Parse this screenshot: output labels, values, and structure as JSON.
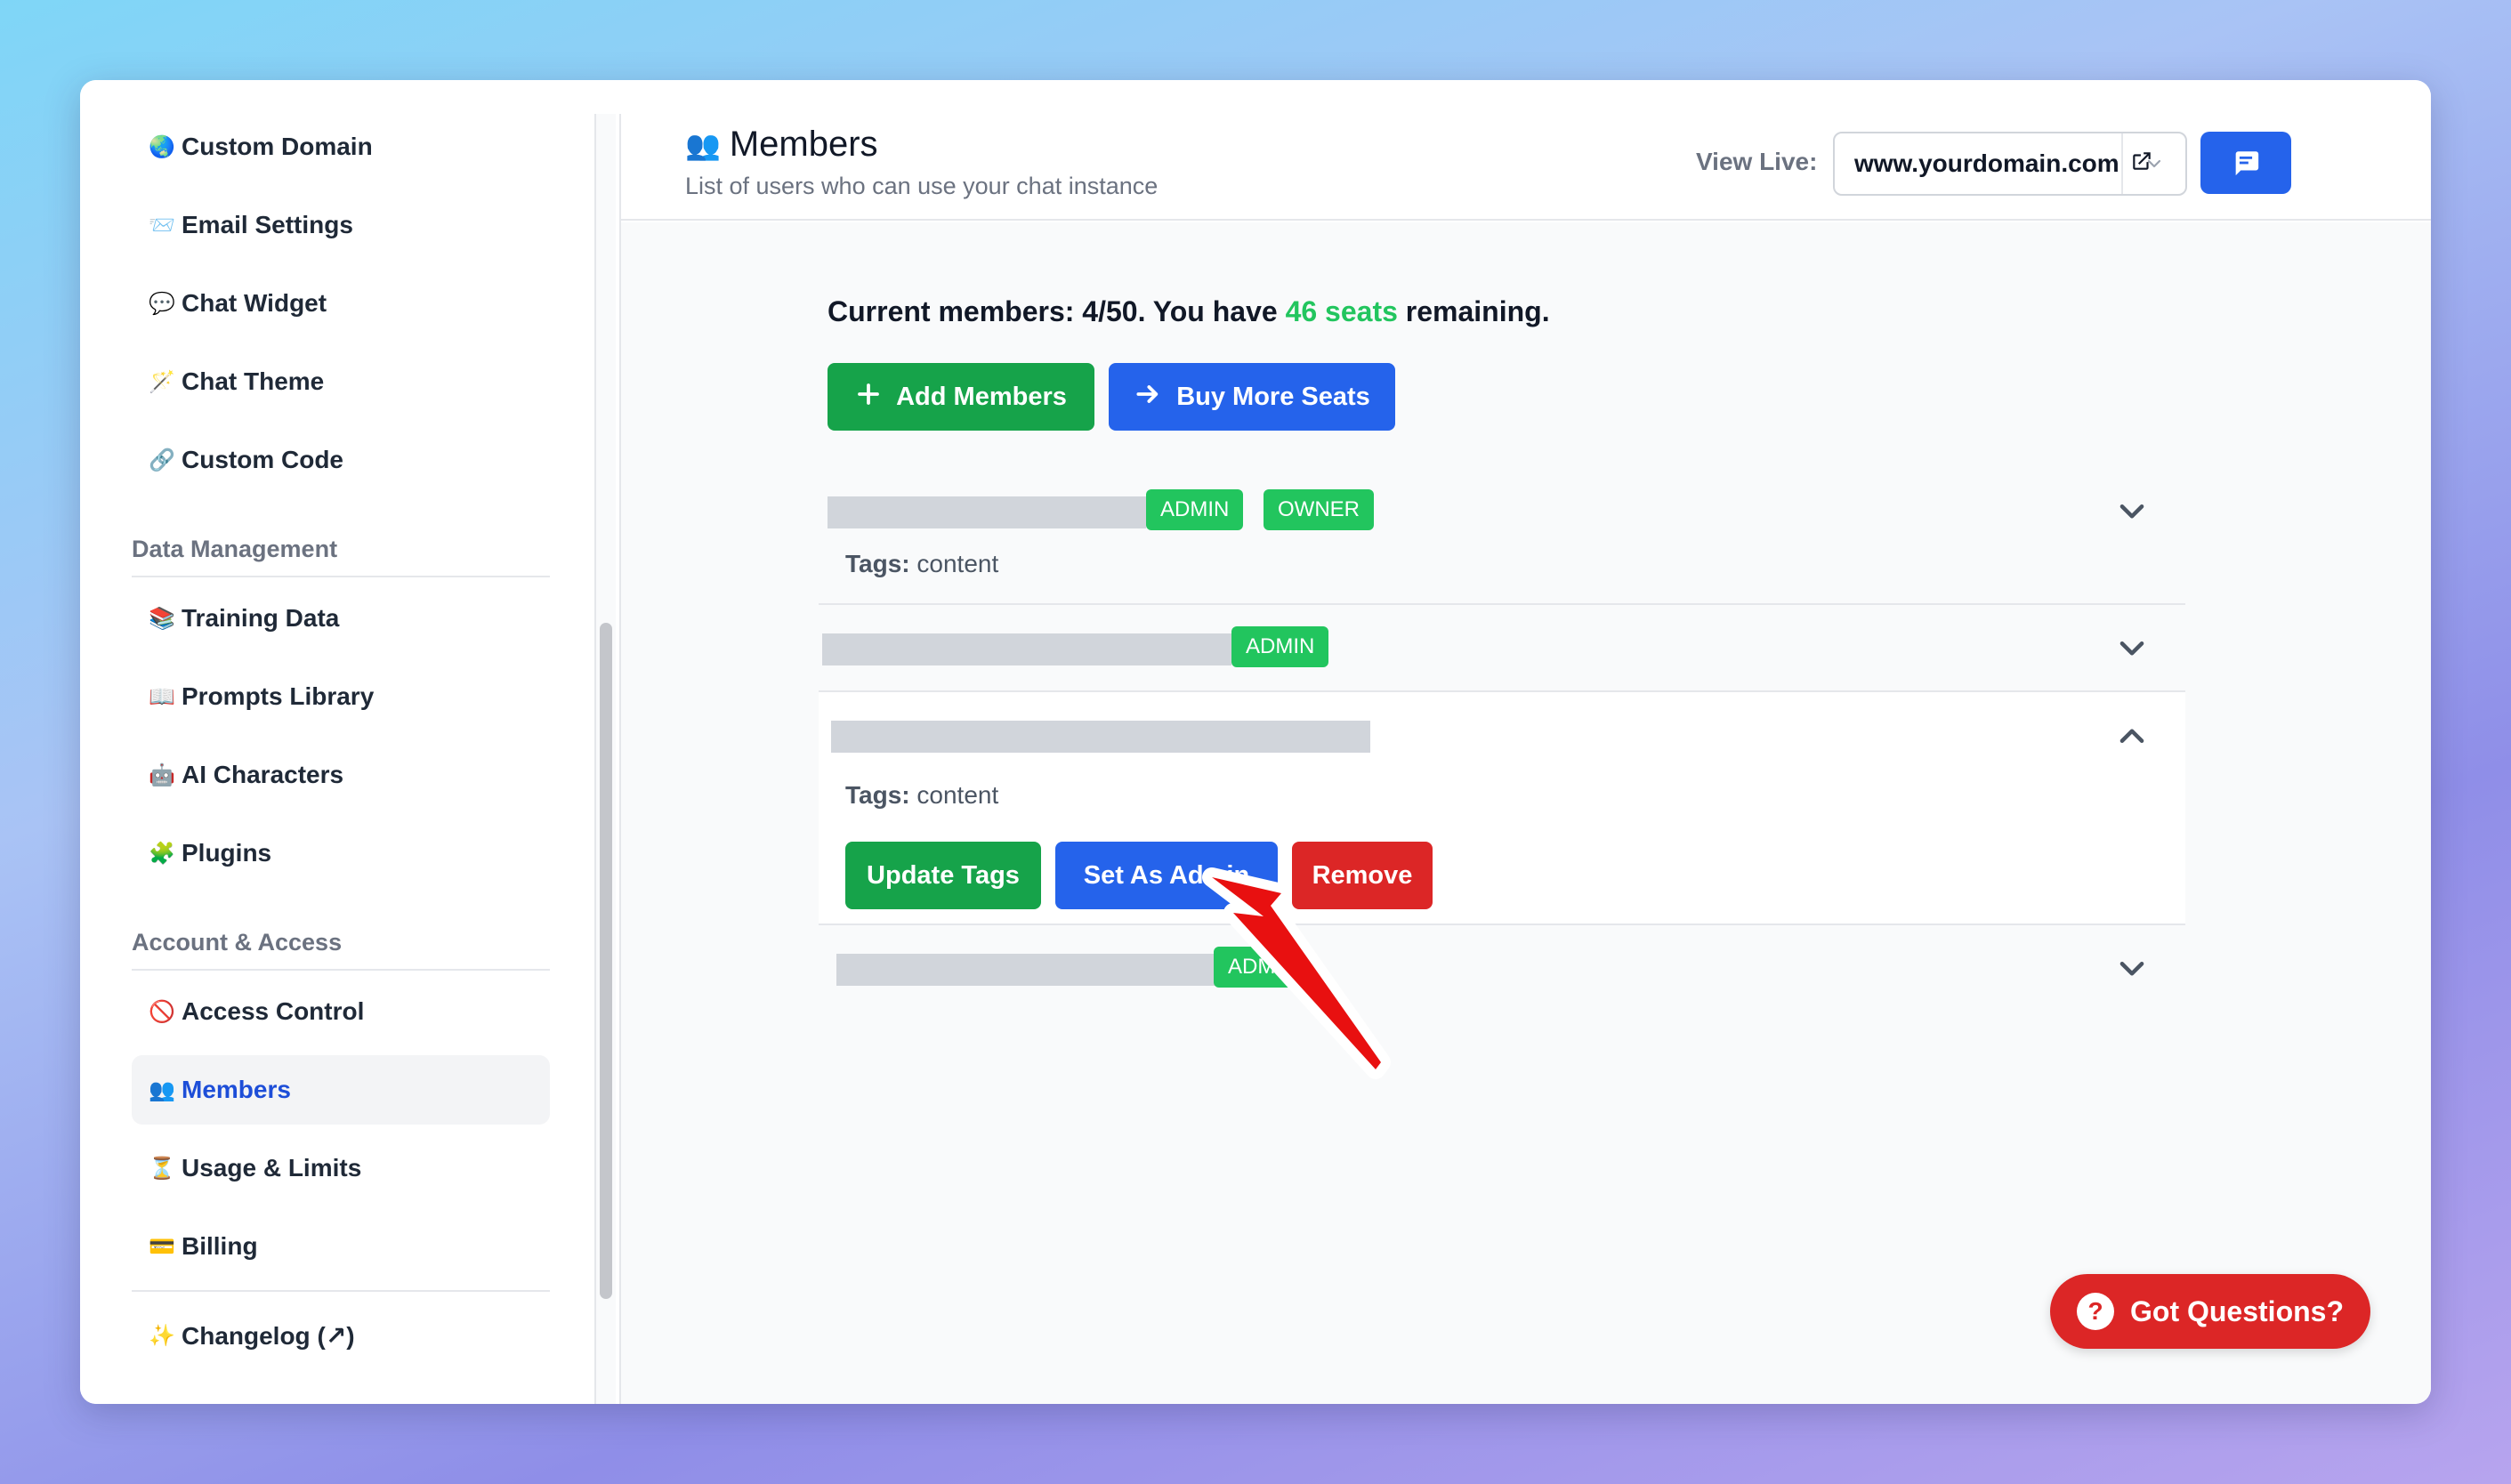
{
  "sidebar": {
    "items_top": [
      {
        "emoji": "🌏",
        "label": "Custom Domain"
      },
      {
        "emoji": "📨",
        "label": "Email Settings"
      },
      {
        "emoji": "💬",
        "label": "Chat Widget"
      },
      {
        "emoji": "🪄",
        "label": "Chat Theme"
      },
      {
        "emoji": "🔗",
        "label": "Custom Code"
      }
    ],
    "section_data": "Data Management",
    "items_data": [
      {
        "emoji": "📚",
        "label": "Training Data"
      },
      {
        "emoji": "📖",
        "label": "Prompts Library"
      },
      {
        "emoji": "🤖",
        "label": "AI Characters"
      },
      {
        "emoji": "🧩",
        "label": "Plugins"
      }
    ],
    "section_account": "Account & Access",
    "items_account": [
      {
        "emoji": "🚫",
        "label": "Access Control"
      },
      {
        "emoji": "👥",
        "label": "Members"
      },
      {
        "emoji": "⏳",
        "label": "Usage & Limits"
      },
      {
        "emoji": "💳",
        "label": "Billing"
      }
    ],
    "changelog": {
      "emoji": "✨",
      "label": "Changelog (↗)"
    }
  },
  "header": {
    "title_emoji": "👥",
    "title": "Members",
    "subtitle": "List of users who can use your chat instance",
    "view_live_label": "View Live:",
    "domain": "www.yourdomain.com"
  },
  "main": {
    "count_prefix": "Current members: 4/50. You have ",
    "count_highlight": "46 seats",
    "count_suffix": " remaining.",
    "add_members_label": "Add Members",
    "buy_seats_label": "Buy More Seats",
    "members": [
      {
        "badges": [
          "ADMIN",
          "OWNER"
        ],
        "tags_label": "Tags:",
        "tags": "content"
      },
      {
        "badges": [
          "ADMIN"
        ]
      },
      {
        "badges": [],
        "tags_label": "Tags:",
        "tags": "content",
        "actions": [
          "Update Tags",
          "Set As Admin",
          "Remove"
        ]
      },
      {
        "badges": [
          "ADMIN"
        ]
      }
    ]
  },
  "help_label": "Got Questions?",
  "colors": {
    "primary_blue": "#2563eb",
    "green": "#16a34a",
    "badge_green": "#22c55e",
    "red": "#dc2626"
  }
}
